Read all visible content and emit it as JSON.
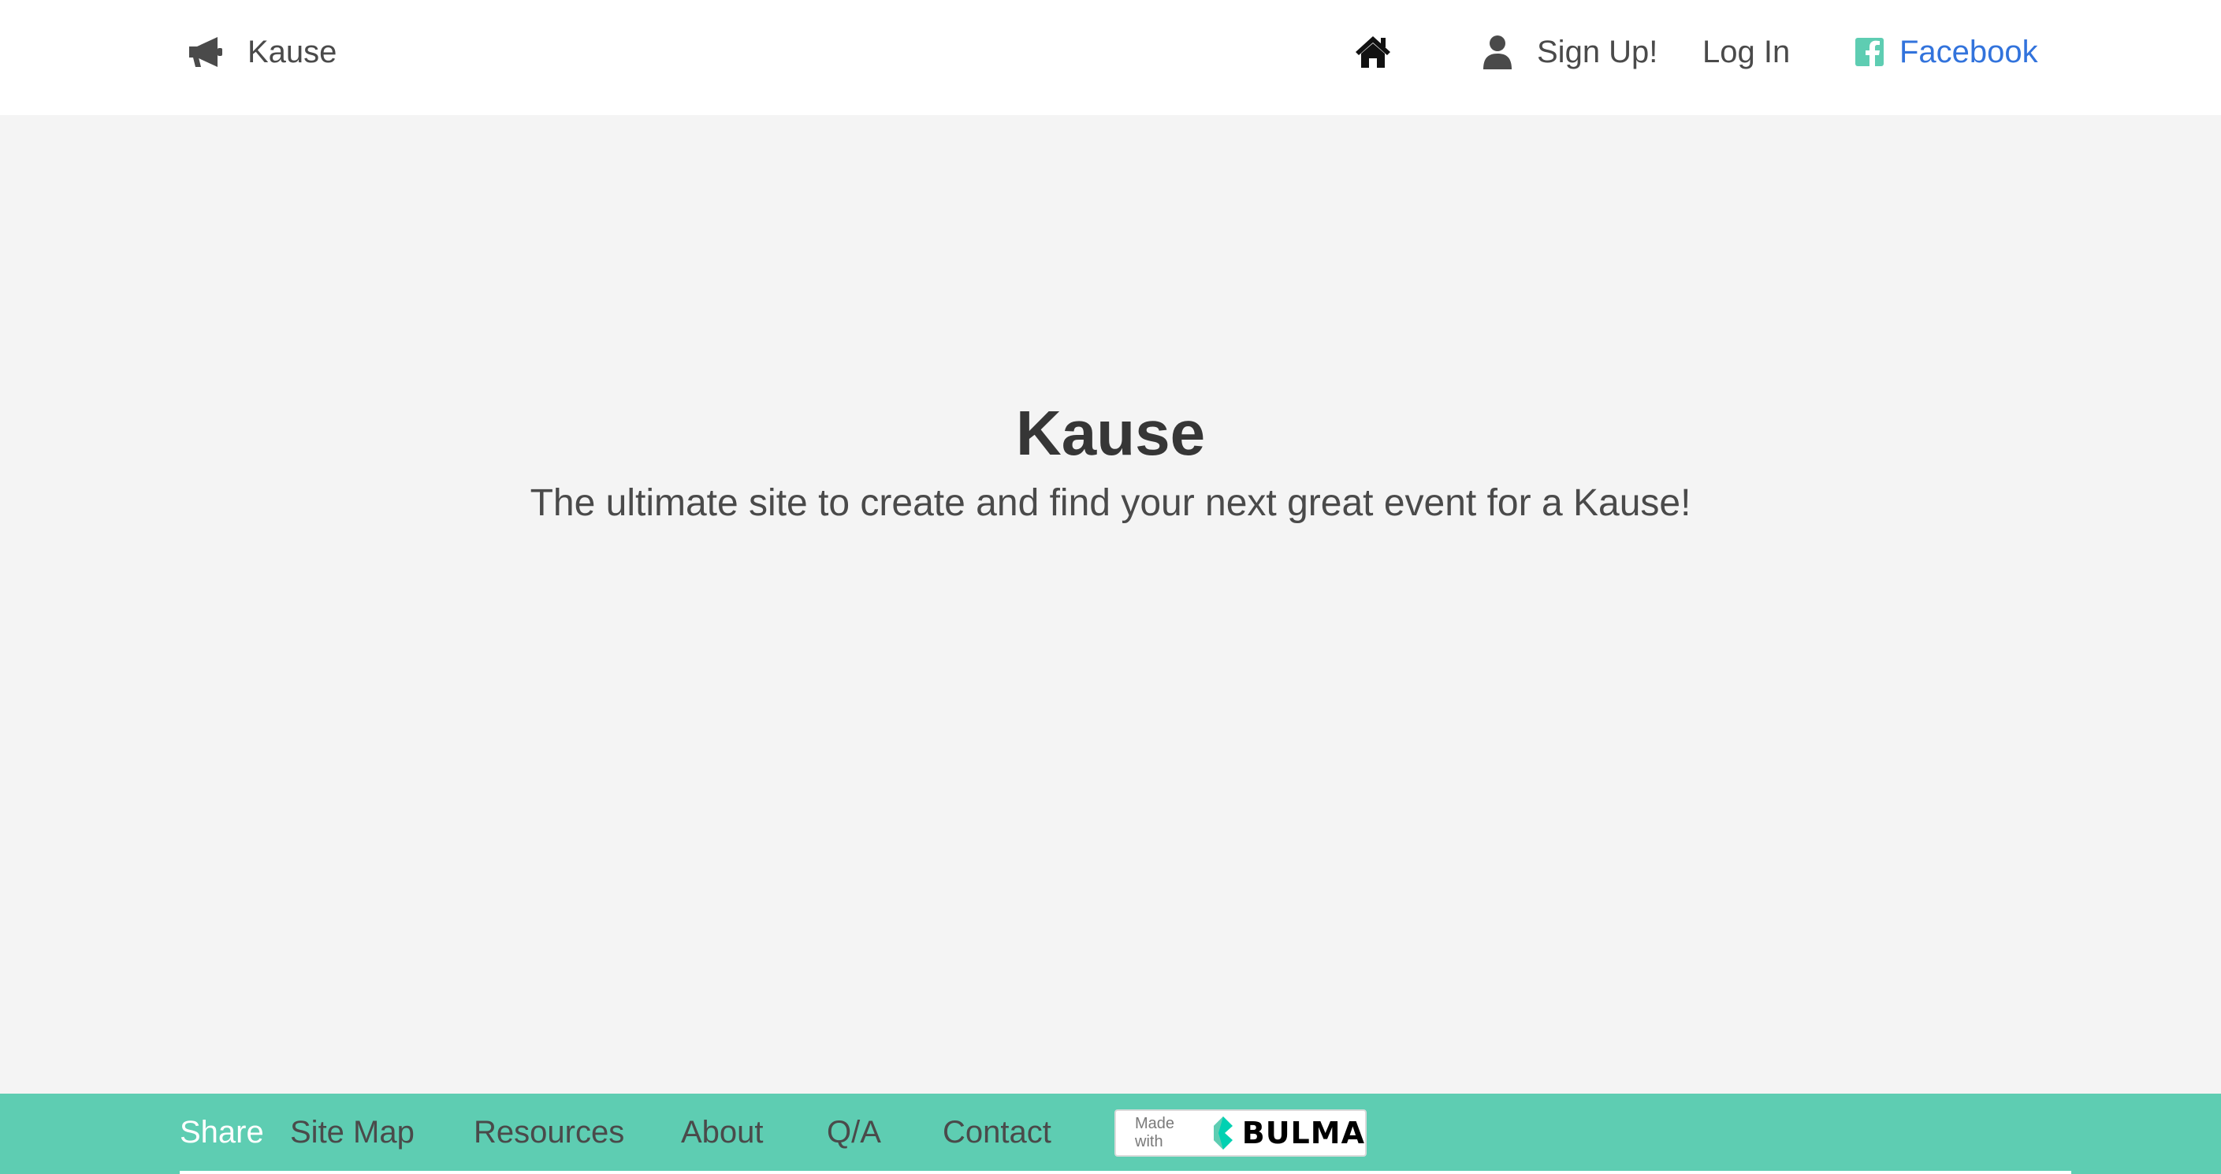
{
  "navbar": {
    "brand": {
      "label": "Kause",
      "icon": "megaphone-icon"
    },
    "home": {
      "icon": "home-icon"
    },
    "signup": {
      "label": "Sign Up!",
      "icon": "user-icon"
    },
    "login": {
      "label": "Log In"
    },
    "facebook": {
      "label": "Facebook",
      "icon": "facebook-icon"
    }
  },
  "hero": {
    "title": "Kause",
    "subtitle": "The ultimate site to create and find your next great event for a Kause!"
  },
  "footer": {
    "share": "Share",
    "links": {
      "sitemap": "Site Map",
      "resources": "Resources",
      "about": "About",
      "qa": "Q/A",
      "contact": "Contact"
    },
    "badge": {
      "made_with": "Made with",
      "brand": "BULMA"
    }
  },
  "colors": {
    "footer_bg": "#5ecdb2",
    "hero_bg": "#f4f4f4",
    "link_blue": "#3273dc",
    "facebook_icon": "#5ecdb2",
    "text_dark": "#363636"
  }
}
